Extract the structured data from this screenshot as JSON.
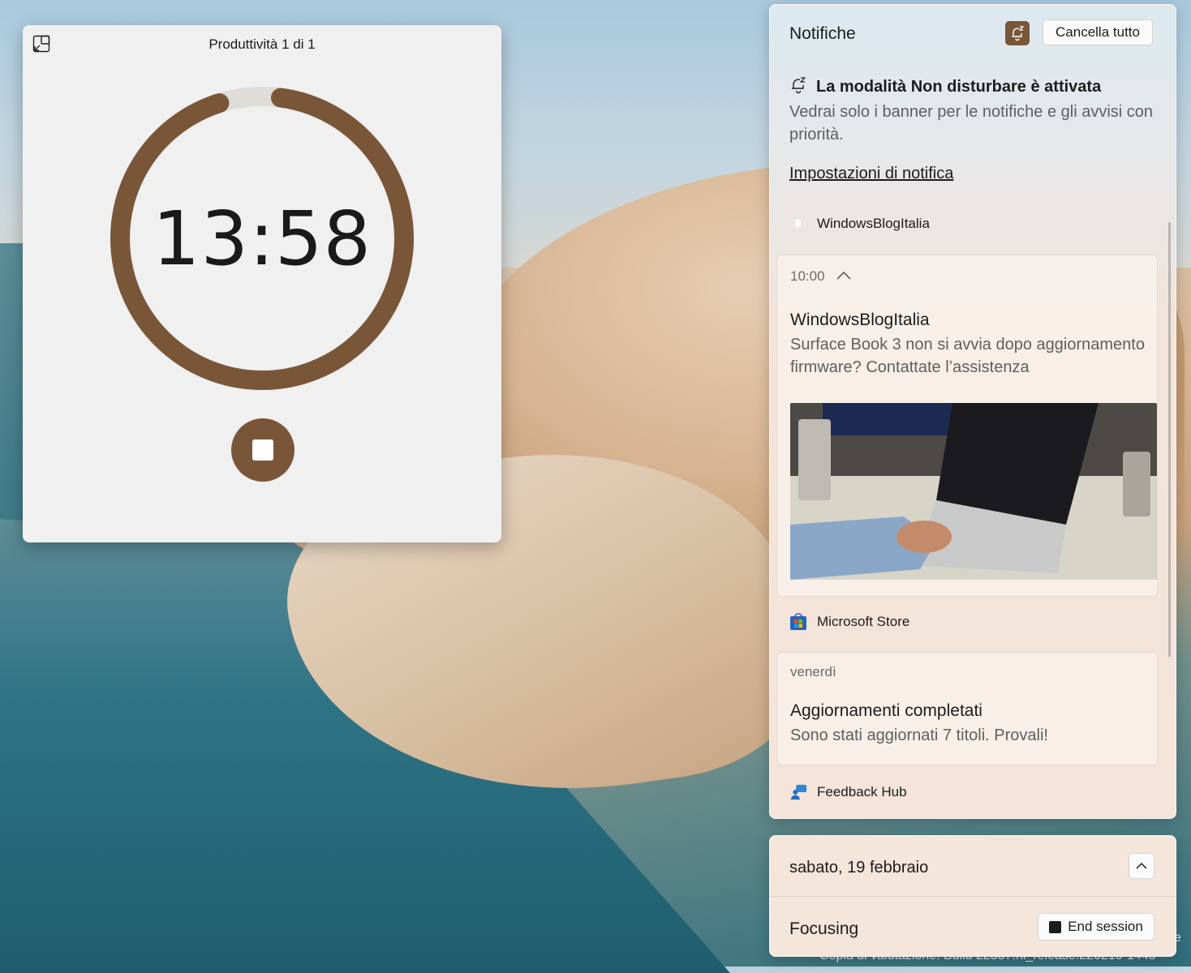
{
  "desktop": {
    "watermark": "Copia di valutazione. Build 22557.ni_release.220210-1445",
    "watermark_fragment": "ne"
  },
  "timer": {
    "title": "Produttività 1 di 1",
    "time": "13:58",
    "progress_fraction": 0.93,
    "accent": "#7a5638",
    "compact_icon": "compact-overlay-icon",
    "stop_icon": "stop-icon"
  },
  "notifications": {
    "title": "Notifiche",
    "clear_all": "Cancella tutto",
    "dnd_icon": "do-not-disturb-icon",
    "dnd_title": "La modalità Non disturbare è attivata",
    "dnd_desc": "Vedrai solo i banner per le notifiche e gli avvisi con priorità.",
    "settings_link": "Impostazioni di notifica",
    "groups": [
      {
        "app": "WindowsBlogItalia",
        "icon": "windowsblogitalia-icon",
        "time": "10:00",
        "title": "WindowsBlogItalia",
        "body": "Surface Book 3 non si avvia dopo aggiornamento firmware? Contattate l’assistenza",
        "image": "laptop-photo"
      },
      {
        "app": "Microsoft Store",
        "icon": "microsoft-store-icon",
        "time": "venerdì",
        "title": "Aggiornamenti completati",
        "body": "Sono stati aggiornati 7 titoli. Provali!"
      },
      {
        "app": "Feedback Hub",
        "icon": "feedback-hub-icon"
      }
    ]
  },
  "calendar": {
    "date": "sabato, 19 febbraio",
    "collapse_icon": "chevron-up-icon",
    "focus_label": "Focusing",
    "end_session": "End session"
  }
}
